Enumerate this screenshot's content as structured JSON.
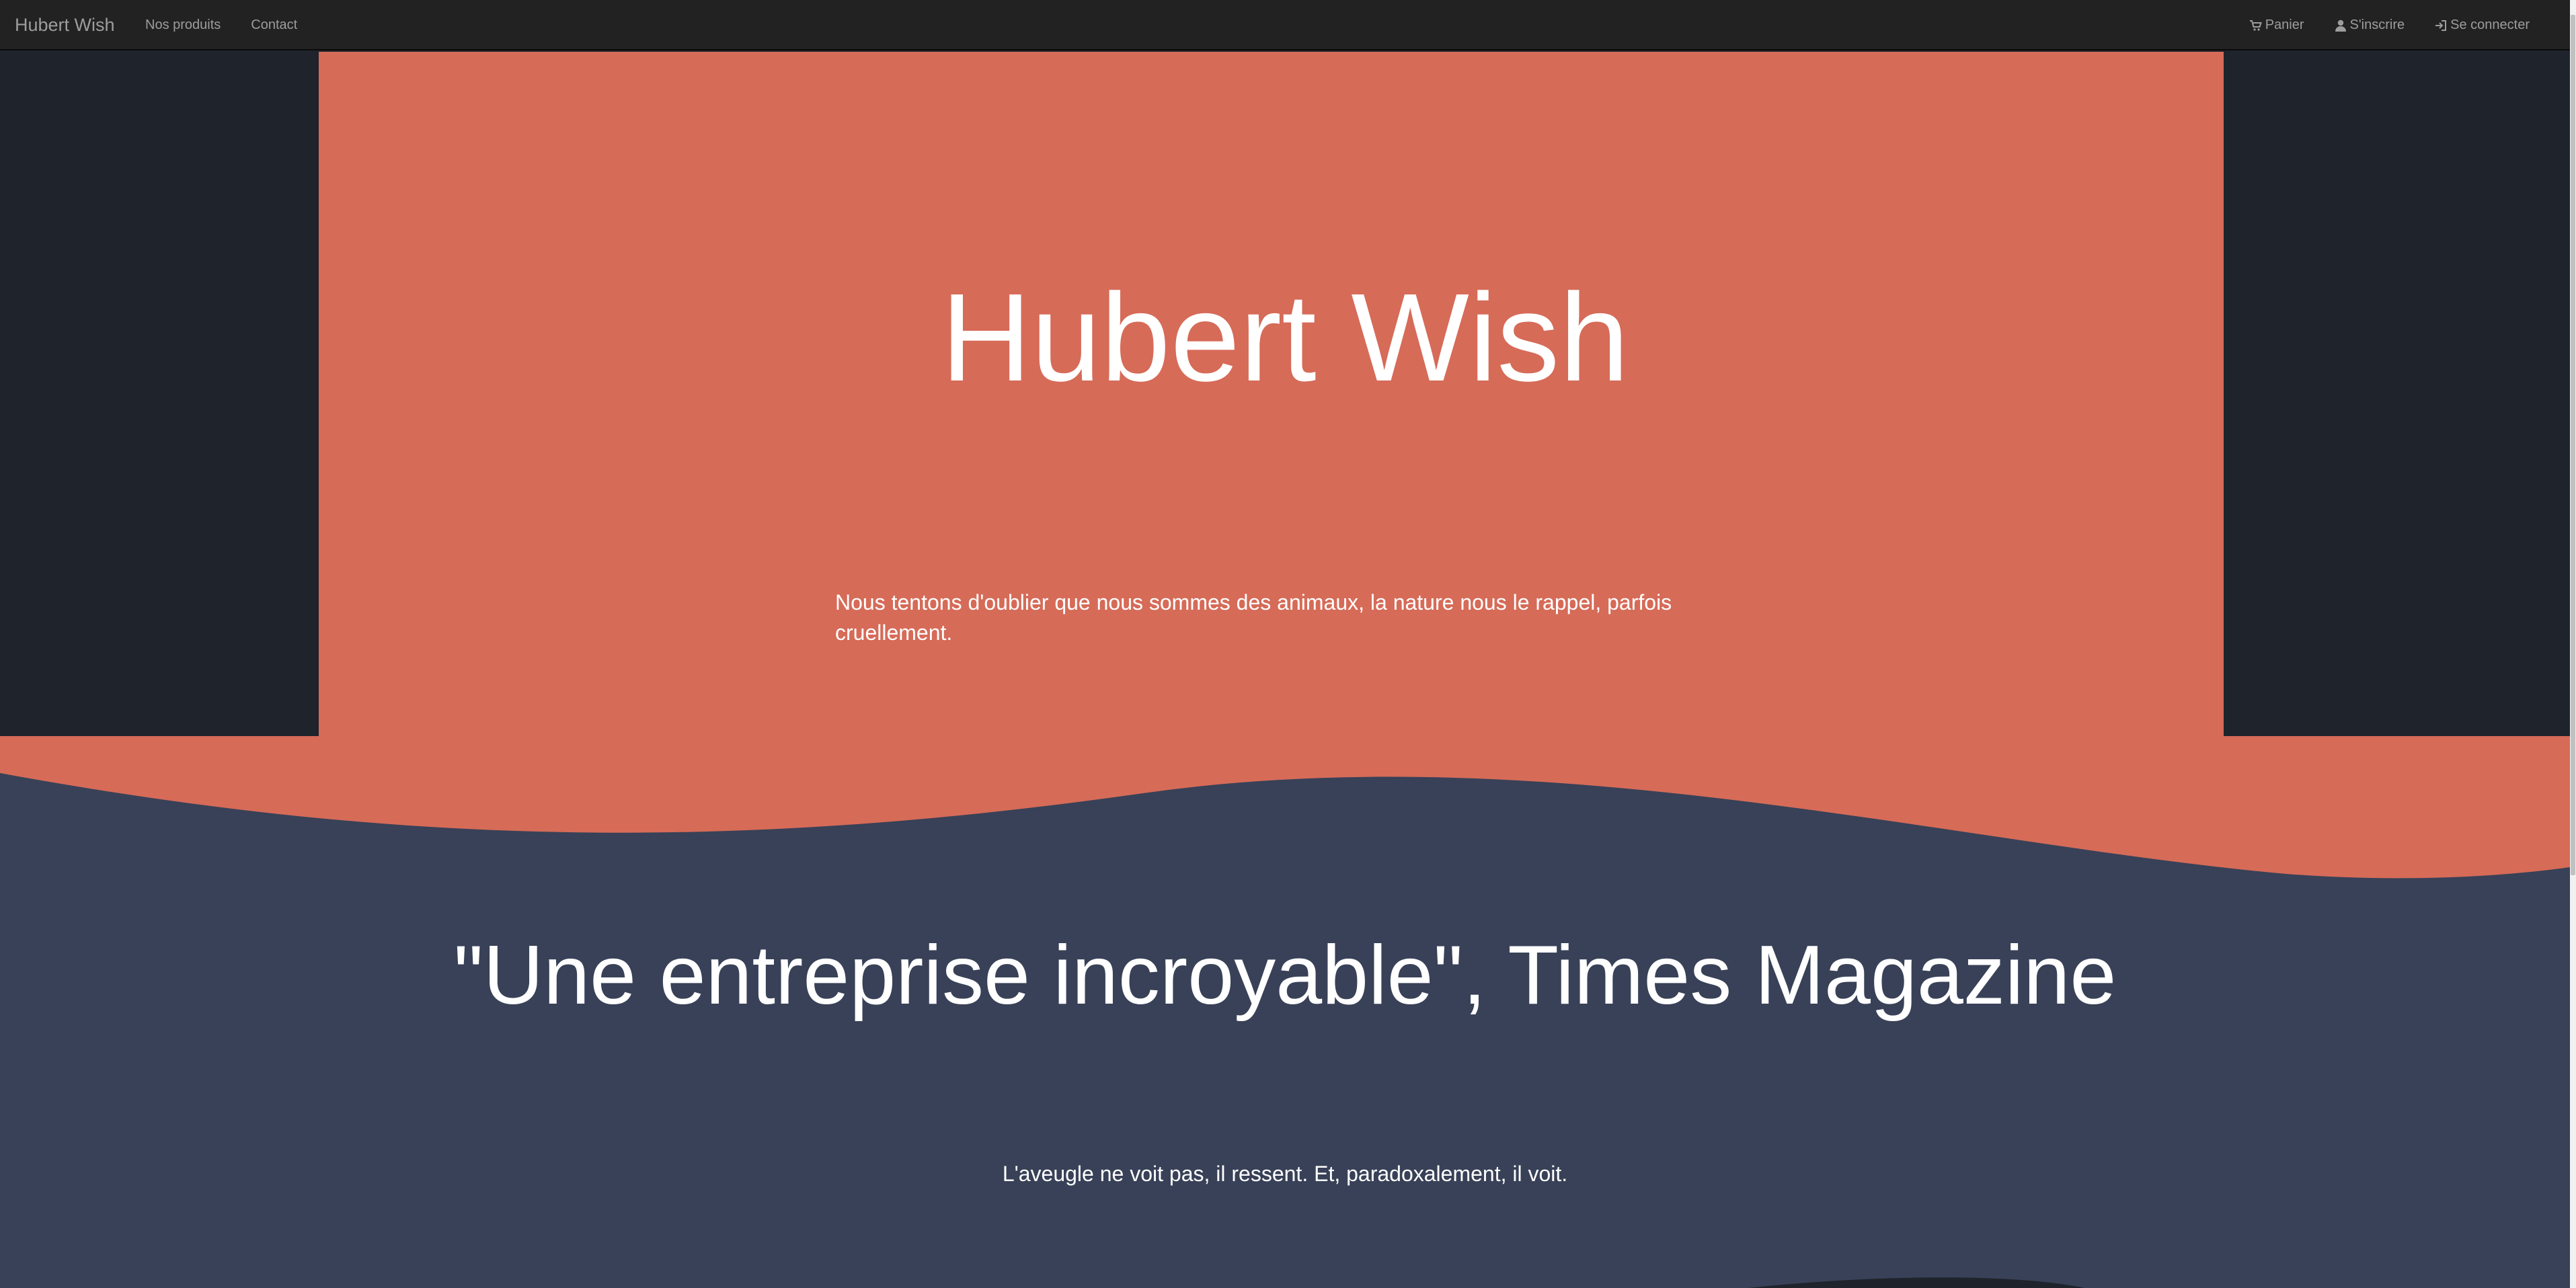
{
  "navbar": {
    "brand": "Hubert Wish",
    "links": [
      {
        "label": "Nos produits"
      },
      {
        "label": "Contact"
      }
    ],
    "right_links": [
      {
        "label": "Panier",
        "icon": "cart-icon"
      },
      {
        "label": "S'inscrire",
        "icon": "user-icon"
      },
      {
        "label": "Se connecter",
        "icon": "login-icon"
      }
    ]
  },
  "hero": {
    "title": "Hubert Wish",
    "text": "Nous tentons d'oublier que nous sommes des animaux, la nature nous le rappel, parfois cruellement."
  },
  "testimonial": {
    "quote": "\"Une entreprise incroyable\", Times Magazine",
    "subtext": "L'aveugle ne voit pas, il ressent. Et, paradoxalement, il voit."
  },
  "colors": {
    "navbar": "#222222",
    "hero_accent": "#d66b58",
    "dark_side": "#1f242c",
    "section_bg": "#384157",
    "text": "#ffffff",
    "nav_text": "#9d9d9d"
  }
}
